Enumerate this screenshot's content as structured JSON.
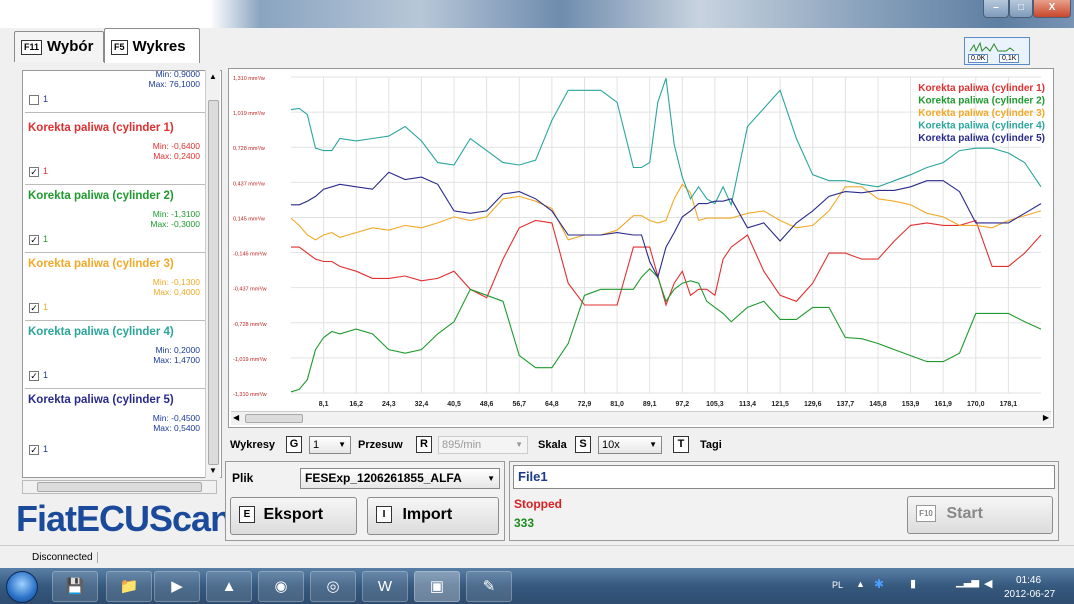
{
  "window": {
    "min_label": "–",
    "max_label": "□",
    "close_label": "X"
  },
  "tabs": [
    {
      "key": "F11",
      "label": "Wybór"
    },
    {
      "key": "F5",
      "label": "Wykres"
    }
  ],
  "mini_meter": {
    "left": "0,0K",
    "right": "0,1K"
  },
  "top_sensor": {
    "min": "Min: 0,9000",
    "max": "Max: 76,1000",
    "count": "1"
  },
  "sensors": [
    {
      "name": "Korekta paliwa (cylinder 1)",
      "min": "Min: -0,6400",
      "max": "Max: 0,2400",
      "count": "1",
      "color": "#e03030"
    },
    {
      "name": "Korekta paliwa (cylinder 2)",
      "min": "Min: -1,3100",
      "max": "Max: -0,3000",
      "count": "1",
      "color": "#1e9a2e"
    },
    {
      "name": "Korekta paliwa (cylinder 3)",
      "min": "Min: -0,1300",
      "max": "Max: 0,4000",
      "count": "1",
      "color": "#f2a928"
    },
    {
      "name": "Korekta paliwa (cylinder 4)",
      "min": "Min: 0,2000",
      "max": "Max: 1,4700",
      "count": "1",
      "color": "#2aa59c"
    },
    {
      "name": "Korekta paliwa (cylinder 5)",
      "min": "Min: -0,4500",
      "max": "Max: 0,5400",
      "count": "1",
      "color": "#2a2a8c"
    }
  ],
  "logo": "FiatECUScan",
  "chart_data": {
    "type": "line",
    "y_ticks": [
      "1,310 mm³/w",
      "1,019 mm³/w",
      "0,728 mm³/w",
      "0,437 mm³/w",
      "0,145 mm³/w",
      "-0,146 mm³/w",
      "-0,437 mm³/w",
      "-0,728 mm³/w",
      "-1,019 mm³/w",
      "-1,310 mm³/w"
    ],
    "ylim": [
      -1.31,
      1.31
    ],
    "xlim": [
      0,
      184
    ],
    "x_ticks": [
      "8,1",
      "16,2",
      "24,3",
      "32,4",
      "40,5",
      "48,6",
      "56,7",
      "64,8",
      "72,9",
      "81,0",
      "89,1",
      "97,2",
      "105,3",
      "113,4",
      "121,5",
      "129,6",
      "137,7",
      "145,8",
      "153,9",
      "161,9",
      "170,0",
      "178,1"
    ],
    "legend_position": "top-right",
    "grid": true,
    "series": [
      {
        "name": "Korekta paliwa (cylinder 1)",
        "color": "#e03030",
        "x": [
          0,
          2,
          4,
          6,
          8,
          10,
          12,
          16,
          20,
          24,
          28,
          32,
          36,
          40,
          44,
          48,
          52,
          56,
          60,
          64,
          68,
          72,
          76,
          80,
          84,
          86,
          88,
          90,
          92,
          94,
          96,
          98,
          100,
          102,
          104,
          106,
          108,
          112,
          116,
          120,
          124,
          128,
          132,
          136,
          140,
          144,
          148,
          152,
          156,
          160,
          164,
          168,
          172,
          176,
          180,
          184
        ],
        "y": [
          -0.1,
          -0.1,
          -0.15,
          -0.2,
          -0.22,
          -0.22,
          -0.26,
          -0.3,
          -0.36,
          -0.36,
          -0.34,
          -0.38,
          -0.36,
          -0.3,
          -0.45,
          -0.52,
          -0.2,
          0.06,
          0.12,
          0.1,
          -0.4,
          -0.58,
          -0.58,
          -0.58,
          -0.1,
          -0.1,
          -0.1,
          -0.34,
          -0.58,
          -0.4,
          -0.3,
          -0.5,
          -0.45,
          -0.45,
          -0.5,
          -0.2,
          -0.1,
          0.0,
          -0.3,
          -0.5,
          -0.55,
          -0.4,
          -0.15,
          -0.15,
          -0.2,
          -0.2,
          -0.05,
          0.08,
          0.1,
          0.08,
          0.08,
          0.12,
          -0.26,
          -0.26,
          -0.15,
          0.0
        ]
      },
      {
        "name": "Korekta paliwa (cylinder 2)",
        "color": "#1e9a2e",
        "x": [
          0,
          2,
          4,
          6,
          8,
          10,
          12,
          16,
          20,
          24,
          28,
          32,
          36,
          40,
          44,
          48,
          52,
          56,
          60,
          64,
          68,
          72,
          76,
          80,
          84,
          86,
          88,
          90,
          92,
          94,
          96,
          98,
          100,
          102,
          104,
          106,
          108,
          112,
          116,
          120,
          124,
          128,
          132,
          136,
          140,
          144,
          148,
          152,
          156,
          160,
          164,
          168,
          172,
          176,
          180,
          184
        ],
        "y": [
          -1.3,
          -1.28,
          -1.2,
          -0.95,
          -0.85,
          -0.8,
          -0.82,
          -0.78,
          -0.82,
          -0.95,
          -0.98,
          -0.95,
          -0.82,
          -0.72,
          -0.45,
          -0.5,
          -0.55,
          -1.0,
          -1.1,
          -1.1,
          -0.9,
          -0.5,
          -0.45,
          -0.45,
          -0.45,
          -0.35,
          -0.28,
          -0.35,
          -0.55,
          -0.45,
          -0.4,
          -0.38,
          -0.4,
          -0.55,
          -0.6,
          -0.65,
          -0.72,
          -0.6,
          -0.55,
          -0.7,
          -0.7,
          -0.6,
          -0.6,
          -0.85,
          -0.86,
          -0.9,
          -0.95,
          -1.0,
          -1.05,
          -1.05,
          -0.98,
          -0.65,
          -0.65,
          -0.65,
          -0.72,
          -0.78
        ]
      },
      {
        "name": "Korekta paliwa (cylinder 3)",
        "color": "#f2a928",
        "x": [
          0,
          2,
          4,
          6,
          8,
          10,
          12,
          16,
          20,
          24,
          28,
          32,
          36,
          40,
          44,
          48,
          52,
          56,
          60,
          64,
          68,
          72,
          76,
          80,
          84,
          86,
          88,
          90,
          92,
          94,
          96,
          98,
          100,
          102,
          104,
          106,
          108,
          112,
          116,
          120,
          124,
          128,
          132,
          136,
          140,
          144,
          148,
          152,
          156,
          160,
          164,
          168,
          172,
          176,
          180,
          184
        ],
        "y": [
          0.14,
          0.08,
          0.0,
          -0.04,
          0.0,
          0.02,
          -0.02,
          0.02,
          0.06,
          0.04,
          0.08,
          0.06,
          0.1,
          0.15,
          0.12,
          0.15,
          0.3,
          0.32,
          0.28,
          0.22,
          -0.04,
          0.0,
          0.0,
          0.04,
          0.16,
          0.16,
          0.12,
          0.1,
          0.12,
          0.3,
          0.42,
          0.35,
          0.12,
          0.14,
          0.14,
          0.14,
          0.14,
          0.18,
          0.2,
          0.12,
          0.06,
          0.08,
          0.2,
          0.4,
          0.4,
          0.3,
          0.28,
          0.25,
          0.18,
          0.15,
          0.08,
          0.08,
          0.06,
          0.12,
          0.16,
          0.2
        ]
      },
      {
        "name": "Korekta paliwa (cylinder 4)",
        "color": "#2aa59c",
        "x": [
          0,
          2,
          4,
          6,
          8,
          10,
          12,
          16,
          20,
          24,
          28,
          32,
          36,
          40,
          44,
          48,
          52,
          56,
          60,
          64,
          68,
          72,
          76,
          80,
          84,
          86,
          88,
          90,
          92,
          94,
          96,
          98,
          100,
          102,
          104,
          106,
          108,
          112,
          116,
          120,
          124,
          128,
          132,
          136,
          140,
          144,
          148,
          152,
          156,
          160,
          164,
          168,
          172,
          176,
          180,
          184
        ],
        "y": [
          1.04,
          1.05,
          1.0,
          0.72,
          0.7,
          0.7,
          0.8,
          0.78,
          0.8,
          0.82,
          0.9,
          0.78,
          0.6,
          0.58,
          0.8,
          0.7,
          0.6,
          0.58,
          0.62,
          0.95,
          1.2,
          1.2,
          1.2,
          1.1,
          0.56,
          0.56,
          0.6,
          1.1,
          1.3,
          0.75,
          0.48,
          0.3,
          0.4,
          0.3,
          0.26,
          0.4,
          0.25,
          0.9,
          1.05,
          1.2,
          0.8,
          0.5,
          0.45,
          0.45,
          0.42,
          0.4,
          0.45,
          0.5,
          0.56,
          0.6,
          0.7,
          0.72,
          0.72,
          0.68,
          0.6,
          0.4
        ]
      },
      {
        "name": "Korekta paliwa (cylinder 5)",
        "color": "#2a2a8c",
        "x": [
          0,
          2,
          4,
          6,
          8,
          10,
          12,
          16,
          20,
          24,
          28,
          32,
          36,
          40,
          44,
          48,
          52,
          56,
          60,
          64,
          68,
          72,
          76,
          80,
          84,
          86,
          88,
          90,
          92,
          94,
          96,
          98,
          100,
          102,
          104,
          106,
          108,
          112,
          116,
          120,
          124,
          128,
          132,
          136,
          140,
          144,
          148,
          152,
          156,
          160,
          164,
          168,
          172,
          176,
          180,
          184
        ],
        "y": [
          0.25,
          0.25,
          0.28,
          0.32,
          0.38,
          0.4,
          0.42,
          0.4,
          0.38,
          0.52,
          0.46,
          0.48,
          0.42,
          0.2,
          0.18,
          0.2,
          0.34,
          0.36,
          0.3,
          0.2,
          0.0,
          0.0,
          0.0,
          0.02,
          0.0,
          0.0,
          -0.22,
          -0.35,
          -0.1,
          0.02,
          0.15,
          0.2,
          0.26,
          0.26,
          0.28,
          0.28,
          0.3,
          0.06,
          0.1,
          -0.05,
          0.1,
          0.2,
          0.32,
          0.36,
          0.35,
          0.37,
          0.37,
          0.4,
          0.45,
          0.45,
          0.36,
          0.1,
          0.1,
          0.1,
          0.18,
          0.26
        ]
      }
    ]
  },
  "controls": {
    "wykresy_label": "Wykresy",
    "wykresy_key": "G",
    "wykresy_value": "1",
    "przesuw_label": "Przesuw",
    "przesuw_key": "R",
    "przesuw_value": "895/min",
    "skala_label": "Skala",
    "skala_key": "S",
    "skala_value": "10x",
    "tagi_key": "T",
    "tagi_label": "Tagi",
    "plik_label": "Plik",
    "plik_value": "FESExp_1206261855_ALFA",
    "eksport_key": "E",
    "eksport_label": "Eksport",
    "import_key": "I",
    "import_label": "Import"
  },
  "log": {
    "file": "File1",
    "status": "Stopped",
    "count": "333",
    "start_key": "F10",
    "start_label": "Start"
  },
  "status_bar": {
    "text": "Disconnected"
  },
  "taskbar": {
    "lang": "PL",
    "time": "01:46",
    "date": "2012-06-27"
  }
}
